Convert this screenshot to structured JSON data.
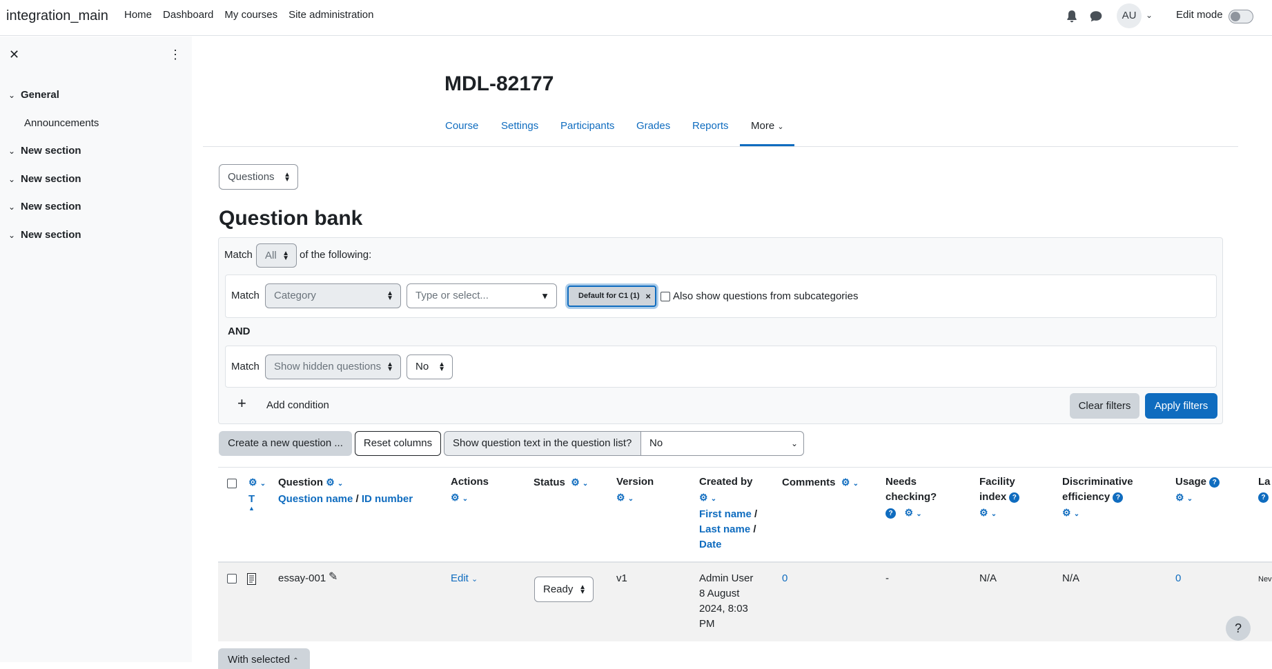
{
  "navbar": {
    "brand": "integration_main",
    "links": [
      "Home",
      "Dashboard",
      "My courses",
      "Site administration"
    ],
    "avatar_initials": "AU",
    "edit_mode_label": "Edit mode",
    "edit_mode_on": false
  },
  "drawer": {
    "sections": [
      {
        "label": "General",
        "items": [
          "Announcements"
        ]
      },
      {
        "label": "New section"
      },
      {
        "label": "New section"
      },
      {
        "label": "New section"
      },
      {
        "label": "New section"
      }
    ]
  },
  "course": {
    "title": "MDL-82177",
    "tabs": [
      "Course",
      "Settings",
      "Participants",
      "Grades",
      "Reports",
      "More"
    ],
    "active_tab": "More"
  },
  "page": {
    "nav_select": "Questions",
    "title": "Question bank"
  },
  "filters": {
    "match_label": "Match",
    "match_value": "All",
    "of_following": "of the following:",
    "condition1": {
      "match": "Match",
      "field": "Category",
      "typeahead_placeholder": "Type or select...",
      "chip": "Default for C1 (1)",
      "subcategories_label": "Also show questions from subcategories"
    },
    "and_label": "AND",
    "condition2": {
      "match": "Match",
      "field": "Show hidden questions",
      "value": "No"
    },
    "add_condition": "Add condition",
    "clear": "Clear filters",
    "apply": "Apply filters"
  },
  "toolbar": {
    "create": "Create a new question ...",
    "reset": "Reset columns",
    "show_text_label": "Show question text in the question list?",
    "show_text_value": "No"
  },
  "table": {
    "headers": {
      "type_sort": "T",
      "question": "Question",
      "question_name": "Question name",
      "id_number": "ID number",
      "actions": "Actions",
      "status": "Status",
      "version": "Version",
      "created_by": "Created by",
      "first_name": "First name",
      "last_name": "Last name",
      "date": "Date",
      "comments": "Comments",
      "needs_checking_1": "Needs",
      "needs_checking_2": "checking?",
      "facility_1": "Facility",
      "facility_2": "index",
      "discrim_1": "Discriminative",
      "discrim_2": "efficiency",
      "usage": "Usage",
      "last": "La"
    },
    "rows": [
      {
        "name": "essay-001",
        "actions": "Edit",
        "status": "Ready",
        "version": "v1",
        "created_1": "Admin User",
        "created_2": "8 August",
        "created_3": "2024, 8:03",
        "created_4": "PM",
        "comments": "0",
        "needs_checking": "-",
        "facility": "N/A",
        "discrim": "N/A",
        "usage": "0",
        "last": "Nev"
      }
    ]
  },
  "footer": {
    "with_selected": "With selected",
    "help": "?"
  }
}
